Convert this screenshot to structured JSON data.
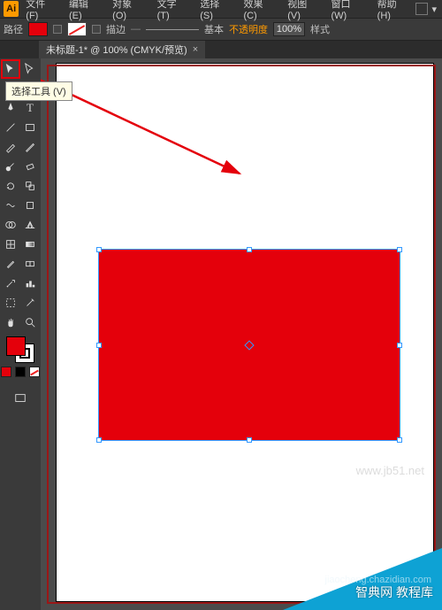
{
  "app": {
    "logo": "Ai"
  },
  "menu": {
    "file": "文件(F)",
    "edit": "编辑(E)",
    "object": "对象(O)",
    "type": "文字(T)",
    "select": "选择(S)",
    "effect": "效果(C)",
    "view": "视图(V)",
    "window": "窗口(W)",
    "help": "帮助(H)"
  },
  "options": {
    "path_label": "路径",
    "stroke_label": "描边",
    "basic_label": "基本",
    "opacity_label": "不透明度",
    "opacity_value": "100%",
    "style_label": "样式",
    "fill_color": "#e4000b"
  },
  "document": {
    "tab_title": "未标题-1* @ 100% (CMYK/预览)",
    "close": "×"
  },
  "tooltip": {
    "text": "选择工具 (V)"
  },
  "tools": {
    "selection": "selection-tool",
    "direct": "direct-selection-tool",
    "wand": "magic-wand-tool",
    "lasso": "lasso-tool",
    "pen": "pen-tool",
    "type": "type-tool",
    "line": "line-tool",
    "rect": "rectangle-tool",
    "brush": "paintbrush-tool",
    "pencil": "pencil-tool",
    "blob": "blob-brush-tool",
    "eraser": "eraser-tool",
    "rotate": "rotate-tool",
    "scale": "scale-tool",
    "width": "width-tool",
    "free": "free-transform-tool",
    "shape_builder": "shape-builder-tool",
    "perspective": "perspective-grid-tool",
    "mesh": "mesh-tool",
    "gradient": "gradient-tool",
    "eyedrop": "eyedropper-tool",
    "blend": "blend-tool",
    "symbol": "symbol-sprayer-tool",
    "graph": "column-graph-tool",
    "artboard": "artboard-tool",
    "slice": "slice-tool",
    "hand": "hand-tool",
    "zoom": "zoom-tool"
  },
  "watermarks": {
    "url": "www.jb51.net",
    "brand": "智典网  教程库",
    "sub": "jiaocheng.chazidian.com"
  }
}
